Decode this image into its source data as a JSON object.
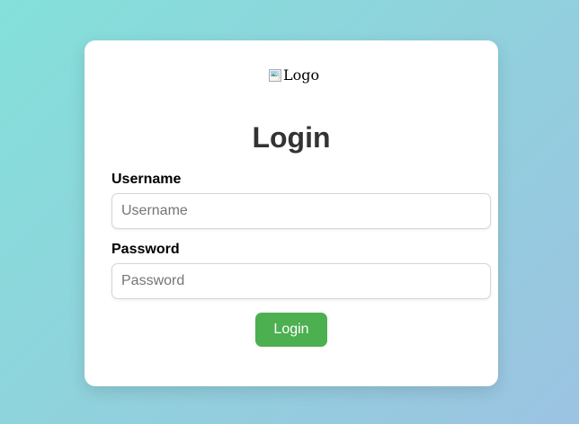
{
  "logo": {
    "alt_text": "Logo",
    "icon": "broken-image-icon"
  },
  "form": {
    "title": "Login",
    "username": {
      "label": "Username",
      "placeholder": "Username",
      "value": ""
    },
    "password": {
      "label": "Password",
      "placeholder": "Password",
      "value": ""
    },
    "submit_label": "Login"
  },
  "colors": {
    "button": "#4caf50",
    "title": "#333333",
    "card": "#ffffff",
    "background_start": "#84e0da",
    "background_end": "#9cc3e2"
  }
}
